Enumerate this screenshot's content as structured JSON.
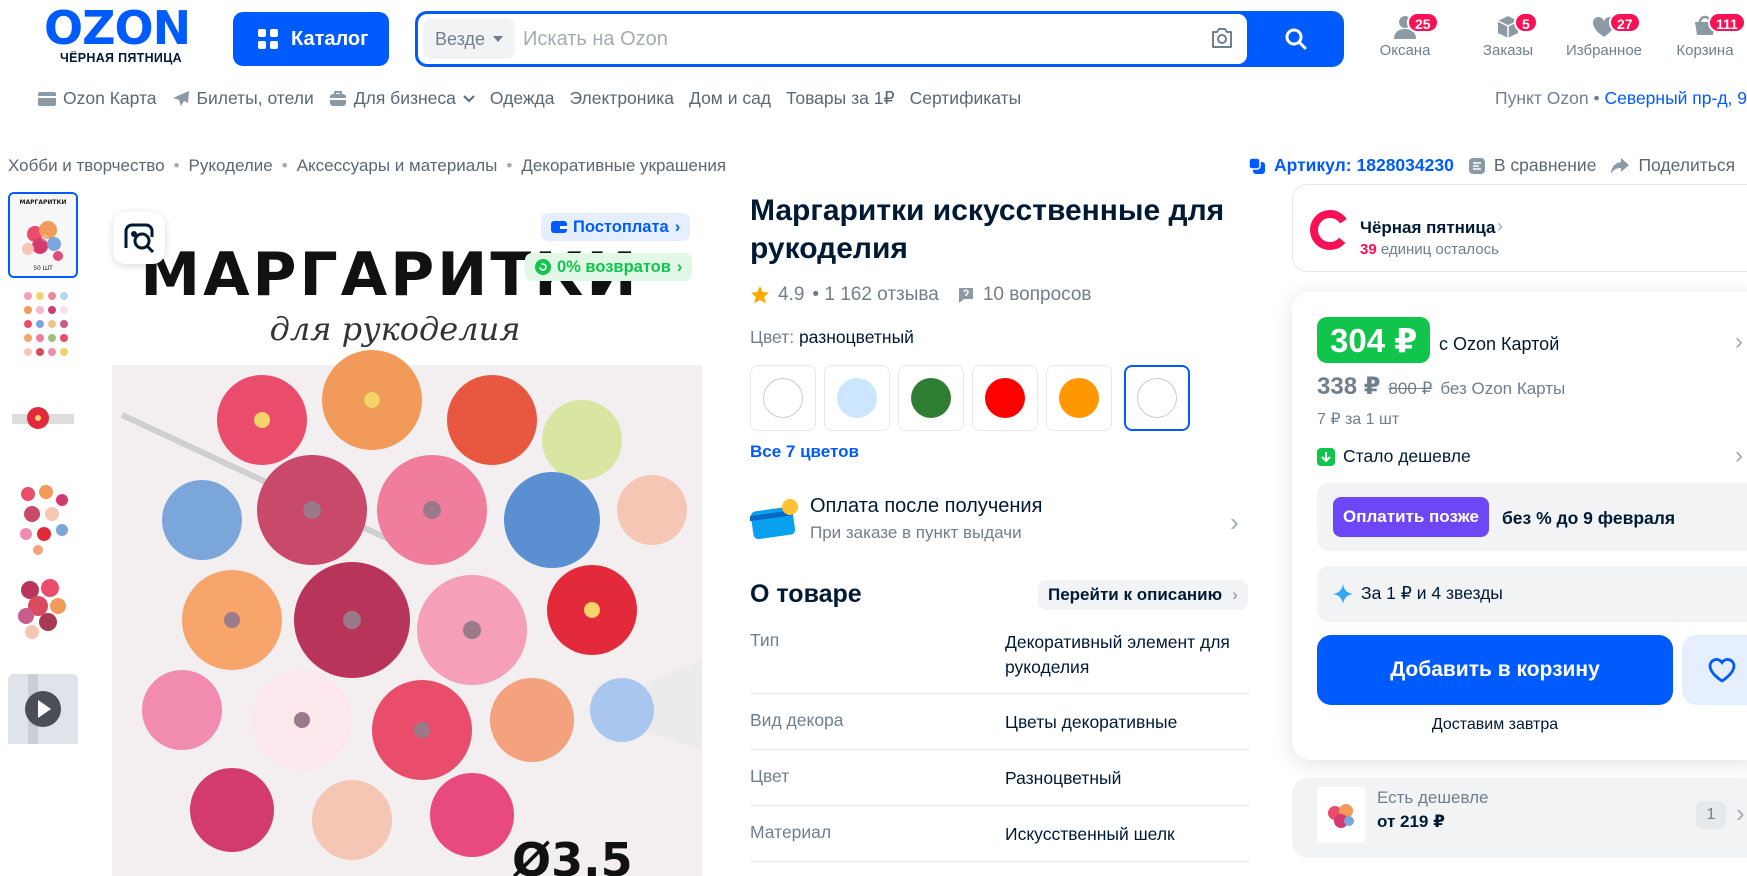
{
  "header": {
    "logo": "OZON",
    "logo_sub": "ЧЁРНАЯ ПЯТНИЦА",
    "catalog": "Каталог",
    "search_scope": "Везде",
    "search_placeholder": "Искать на Ozon",
    "icons": [
      {
        "label": "Оксана",
        "badge": "25",
        "icon": "user-icon"
      },
      {
        "label": "Заказы",
        "badge": "5",
        "icon": "box-icon"
      },
      {
        "label": "Избранное",
        "badge": "27",
        "icon": "heart-icon"
      },
      {
        "label": "Корзина",
        "badge": "111",
        "icon": "cart-icon"
      }
    ]
  },
  "nav": {
    "items": [
      {
        "label": "Ozon Карта",
        "icon": "card-icon"
      },
      {
        "label": "Билеты, отели",
        "icon": "plane-icon"
      },
      {
        "label": "Для бизнеса",
        "icon": "briefcase-icon"
      },
      {
        "label": "Одежда"
      },
      {
        "label": "Электроника"
      },
      {
        "label": "Дом и сад"
      },
      {
        "label": "Товары за 1₽"
      },
      {
        "label": "Сертификаты"
      }
    ],
    "pickup_label": "Пункт Ozon •",
    "pickup_address": "Северный пр-д, 9"
  },
  "breadcrumb": [
    "Хобби и творчество",
    "Рукоделие",
    "Аксессуары и материалы",
    "Декоративные украшения"
  ],
  "actions": {
    "article": "Артикул: 1828034230",
    "compare": "В сравнение",
    "share": "Поделиться"
  },
  "gallery": {
    "tag_postpay": "Постоплата",
    "tag_returns": "0% возвратов",
    "image_title": "МАРГАРИТКИ",
    "image_subtitle": "для рукоделия",
    "image_size": "Ø3.5",
    "thumb_caption": "50 ШТ"
  },
  "product": {
    "title": "Маргаритки искусственные для рукоделия",
    "rating": "4.9",
    "reviews": "• 1 162 отзыва",
    "questions": "10 вопросов",
    "color_label": "Цвет:",
    "color_value": "разноцветный",
    "swatches": [
      "#ffffff",
      "#cce6ff",
      "#2e7d32",
      "#ff0000",
      "#ff9800",
      "#ffffff"
    ],
    "all_colors": "Все 7 цветов",
    "payment_title": "Оплата после получения",
    "payment_sub": "При заказе в пункт выдачи",
    "about_title": "О товаре",
    "about_link": "Перейти к описанию",
    "specs": [
      {
        "key": "Тип",
        "value": "Декоративный элемент для рукоделия"
      },
      {
        "key": "Вид декора",
        "value": "Цветы декоративные"
      },
      {
        "key": "Цвет",
        "value": "Разноцветный"
      },
      {
        "key": "Материал",
        "value": "Искусственный шелк"
      }
    ]
  },
  "buybox": {
    "bf_title": "Чёрная пятница",
    "bf_count": "39",
    "bf_left": "единиц осталось",
    "price_card": "304 ₽",
    "price_card_label": "с Ozon Картой",
    "price": "338 ₽",
    "price_old": "800 ₽",
    "price_label": "без Ozon Карты",
    "unit_price": "7 ₽ за 1 шт",
    "cheaper": "Стало дешевле",
    "pay_later_btn": "Оплатить позже",
    "pay_later_text": "без % до 9 февраля",
    "stars": "За 1 ₽ и 4 звезды",
    "add_to_cart": "Добавить в корзину",
    "delivery": "Доставим завтра",
    "cheaper_offer": "Есть дешевле",
    "cheaper_price": "от 219 ₽",
    "cheaper_count": "1"
  }
}
